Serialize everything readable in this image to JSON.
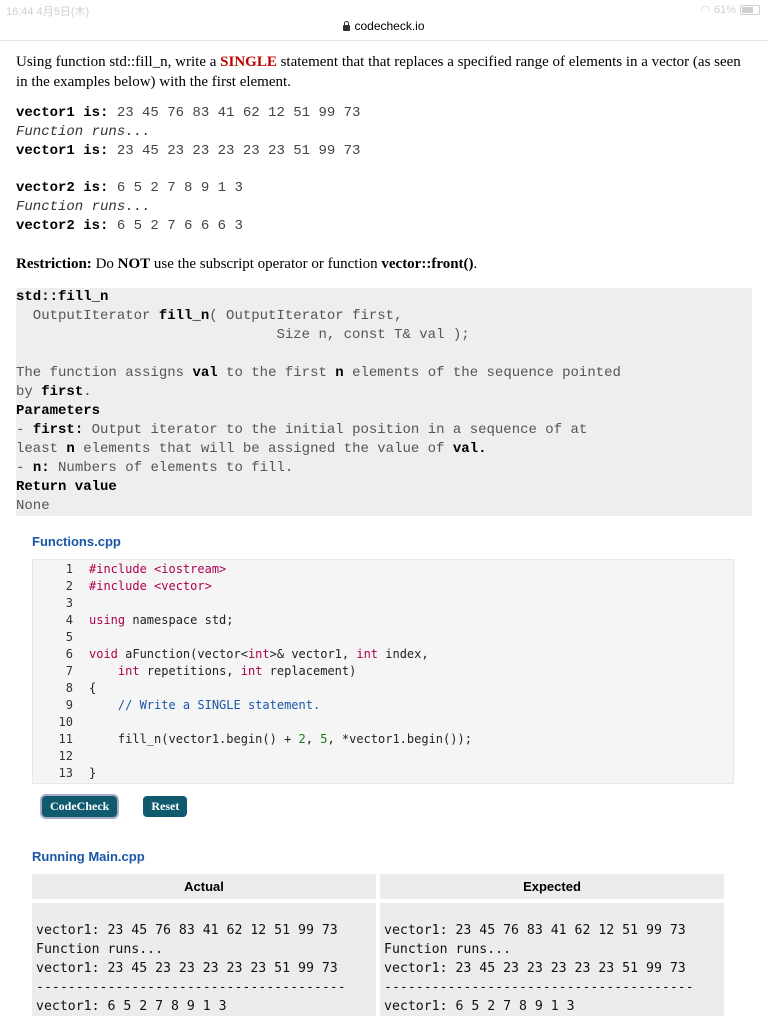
{
  "status": {
    "time": "16:44  4月5日(木)",
    "battery": "61%"
  },
  "browser": {
    "url": "codecheck.io"
  },
  "intro": {
    "before": "Using function std::fill_n, write a ",
    "emph": "SINGLE",
    "after": " statement that that replaces a specified range of elements in a vector (as seen in the examples below) with the first element."
  },
  "examples": [
    {
      "label1": "vector1 is:",
      "before": " 23 45 76 83 41 62 12 51 99 73",
      "runs": "Function runs...",
      "label2": "vector1 is:",
      "after": " 23 45 23 23 23 23 23 51 99 73"
    },
    {
      "label1": "vector2 is:",
      "before": " 6 5 2 7 8 9 1 3",
      "runs": "Function runs...",
      "label2": "vector2 is:",
      "after": " 6 5 2 7 6 6 6 3"
    }
  ],
  "restriction": {
    "label": "Restriction:",
    "t1": " Do ",
    "not": "NOT",
    "t2": " use the subscript operator or function ",
    "fn": "vector::front()",
    "t3": "."
  },
  "docs": {
    "name": "std::fill_n",
    "sig1a": "  OutputIterator ",
    "sig1b": "fill_n",
    "sig1c": "( OutputIterator first,",
    "sig2": "                               Size n, const T& val );",
    "desc_a": "The function assigns ",
    "desc_val": "val",
    "desc_b": " to the first ",
    "desc_n": "n",
    "desc_c": " elements of the sequence pointed",
    "desc_d": "by ",
    "desc_first": "first",
    "desc_e": ".",
    "params_title": "Parameters",
    "p1_dash": "- ",
    "p1_name": "first:",
    "p1_text": " Output iterator to the initial position in a sequence of at",
    "p1_b": "least ",
    "p1_n": "n",
    "p1_c": " elements that will be assigned the value of ",
    "p1_val": "val.",
    "p2_dash": "- ",
    "p2_name": "n:",
    "p2_text": " Numbers of elements to fill.",
    "ret_title": "Return value",
    "ret_text": "None"
  },
  "editor": {
    "title": "Functions.cpp",
    "lines": [
      "1",
      "2",
      "3",
      "4",
      "5",
      "6",
      "7",
      "8",
      "9",
      "10",
      "11",
      "12",
      "13"
    ],
    "l1": "#include <iostream>",
    "l2": "#include <vector>",
    "l4a": "using",
    "l4b": " namespace std;",
    "l6a": "void",
    "l6b": " aFunction(vector<",
    "l6c": "int",
    "l6d": ">& vector1, ",
    "l6e": "int",
    "l6f": " index,",
    "l7a": "    ",
    "l7b": "int",
    "l7c": " repetitions, ",
    "l7d": "int",
    "l7e": " replacement)",
    "l8": "{",
    "l9": "    // Write a SINGLE statement.",
    "l11a": "    fill_n(vector1.begin() + ",
    "l11b": "2",
    "l11c": ", ",
    "l11d": "5",
    "l11e": ", *vector1.begin());",
    "l13": "}"
  },
  "buttons": {
    "codecheck": "CodeCheck",
    "reset": "Reset"
  },
  "running": {
    "title": "Running Main.cpp",
    "actual_header": "Actual",
    "expected_header": "Expected",
    "actual_text": "vector1: 23 45 76 83 41 62 12 51 99 73\nFunction runs...\nvector1: 23 45 23 23 23 23 23 51 99 73\n---------------------------------------\nvector1: 6 5 2 7 8 9 1 3",
    "expected_text": "vector1: 23 45 76 83 41 62 12 51 99 73\nFunction runs...\nvector1: 23 45 23 23 23 23 23 51 99 73\n---------------------------------------\nvector1: 6 5 2 7 8 9 1 3"
  }
}
